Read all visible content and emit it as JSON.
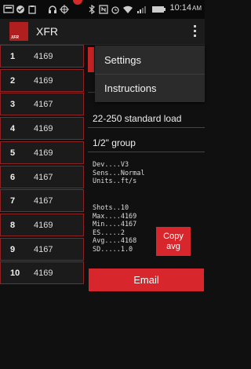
{
  "status_bar": {
    "time": "10:14",
    "time_suffix": "AM"
  },
  "app": {
    "title": "XFR",
    "logo_text": "XFR"
  },
  "shots": [
    {
      "num": "1",
      "value": "4169"
    },
    {
      "num": "2",
      "value": "4169"
    },
    {
      "num": "3",
      "value": "4167"
    },
    {
      "num": "4",
      "value": "4169"
    },
    {
      "num": "5",
      "value": "4169"
    },
    {
      "num": "6",
      "value": "4167"
    },
    {
      "num": "7",
      "value": "4167"
    },
    {
      "num": "8",
      "value": "4169"
    },
    {
      "num": "9",
      "value": "4167"
    },
    {
      "num": "10",
      "value": "4169"
    }
  ],
  "load_field": "22-250 standard load",
  "group_field": "1/2\" group",
  "device_info": "Dev....V3\nSens...Normal\nUnits..ft/s",
  "stats": "Shots..10\nMax....4169\nMin....4167\nES.....2\nAvg....4168\nSD.....1.0",
  "copy_button": {
    "line1": "Copy",
    "line2": "avg"
  },
  "email_button": "Email",
  "menu": {
    "items": [
      "Settings",
      "Instructions"
    ]
  },
  "colors": {
    "accent": "#d7262c",
    "row_border": "#8f2222",
    "background": "#101010"
  }
}
